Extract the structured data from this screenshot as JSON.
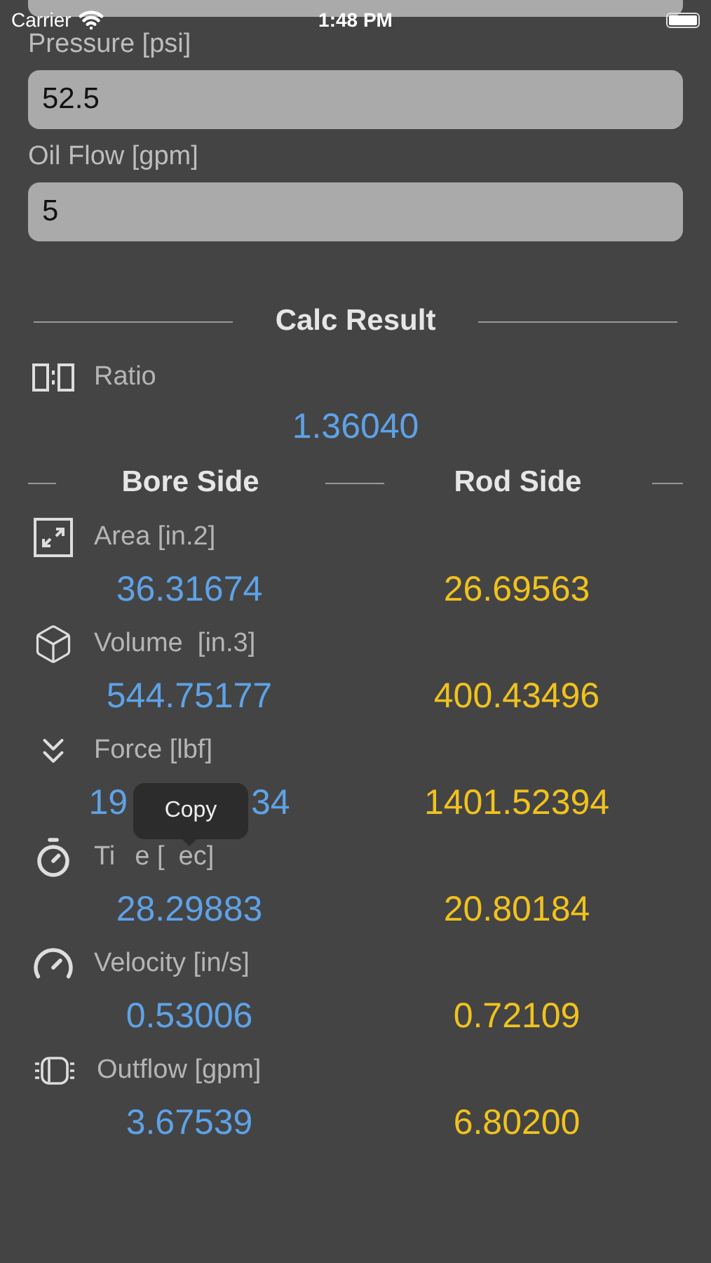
{
  "status_bar": {
    "carrier": "Carrier",
    "time": "1:48 PM"
  },
  "inputs": [
    {
      "label": "Pressure [psi]",
      "value": "52.5"
    },
    {
      "label": "Oil Flow [gpm]",
      "value": "5"
    }
  ],
  "result": {
    "title": "Calc Result",
    "ratio": {
      "label": "Ratio",
      "value": "1.36040"
    },
    "columns": [
      "Bore Side",
      "Rod Side"
    ],
    "rows": [
      {
        "kind": "area",
        "label": [
          "Area [in.2]"
        ],
        "bore": [
          "36.31674"
        ],
        "rod": "26.69563"
      },
      {
        "kind": "volume",
        "label": [
          "Volume  [in.3]"
        ],
        "bore": [
          "544.75177"
        ],
        "rod": "400.43496"
      },
      {
        "kind": "force",
        "label": [
          "Force [lbf]"
        ],
        "bore": [
          "19",
          "34"
        ],
        "rod": "1401.52394"
      },
      {
        "kind": "time",
        "label": [
          "Ti",
          "e [",
          "ec]"
        ],
        "bore": [
          "28.29883"
        ],
        "rod": "20.80184"
      },
      {
        "kind": "velocity",
        "label": [
          "Velocity [in/s]"
        ],
        "bore": [
          "0.53006"
        ],
        "rod": "0.72109"
      },
      {
        "kind": "outflow",
        "label": [
          "Outflow [gpm]"
        ],
        "bore": [
          "3.67539"
        ],
        "rod": "6.80200"
      }
    ]
  },
  "tooltip": "Copy"
}
